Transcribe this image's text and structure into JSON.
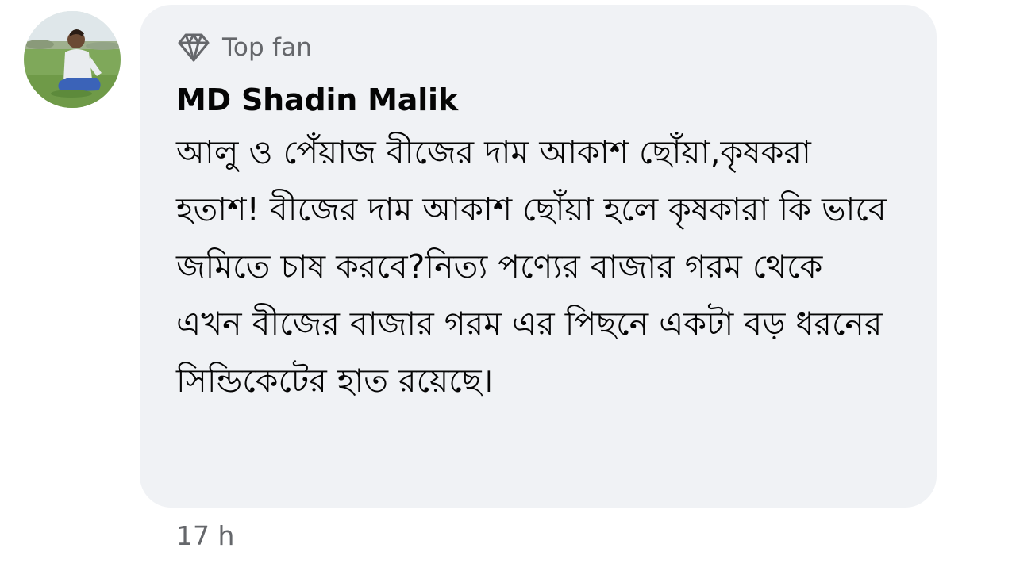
{
  "comment": {
    "author": "MD Shadin Malik",
    "badge": "Top fan",
    "badge_icon": "diamond-icon",
    "text": "আলু ও পেঁয়াজ বীজের দাম আকাশ ছোঁয়া,কৃষকরা হতাশ! বীজের দাম আকাশ ছোঁয়া হলে কৃষকারা কি ভাবে জমিতে চাষ করবে?নিত্য পণ্যের বাজার গরম থেকে এখন বীজের বাজার গরম এর পিছনে একটা বড় ধরনের সিন্ডিকেটের হাত রয়েছে।",
    "timestamp": "17 h"
  },
  "colors": {
    "bubble_background": "#f0f2f5",
    "secondary_text": "#65676b",
    "primary_text": "#050505"
  }
}
